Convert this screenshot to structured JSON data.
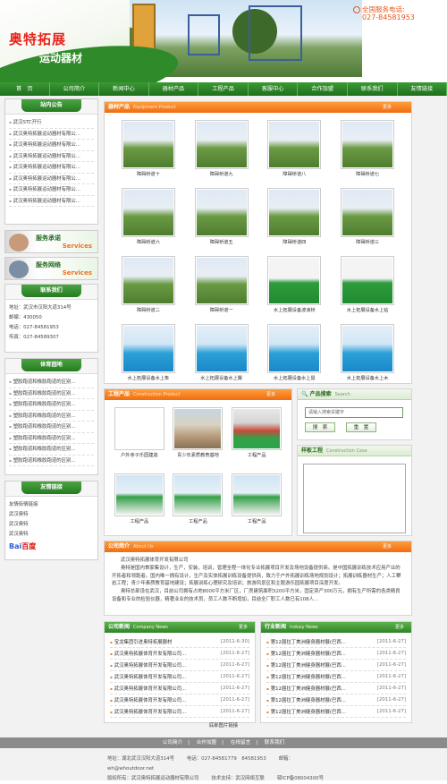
{
  "header": {
    "logo_line1": "奥特拓展",
    "logo_line2": "运动器材",
    "hotline_label": "全国服务电话:",
    "hotline_number": "027-84581953"
  },
  "nav": [
    "首　页",
    "公司简介",
    "新闻中心",
    "器材产品",
    "工程产品",
    "客服中心",
    "合作加盟",
    "联系我们",
    "友情链接"
  ],
  "sidebar": {
    "notice_title": "站内公告",
    "notices": [
      "武汉STC开行",
      "武汉奥特拓展运动器材有限公...",
      "武汉奥特拓展运动器材有限公...",
      "武汉奥特拓展运动器材有限公...",
      "武汉奥特拓展运动器材有限公...",
      "武汉奥特拓展运动器材有限公...",
      "武汉奥特拓展运动器材有限公...",
      "武汉奥特拓展运动器材有限公..."
    ],
    "service1_title": "服务承诺",
    "service1_en": "Services",
    "service2_title": "服务网络",
    "service2_en": "Services",
    "contact_title": "联系我们",
    "contact": [
      "地址：武汉市汉阳大道314号",
      "邮编：430050",
      "电话：027-84581953",
      "传真：027-84589307"
    ],
    "sports_title": "体育园地",
    "sports": [
      "塑胶跑道和橡胶跑道的区别...",
      "塑胶跑道和橡胶跑道的区别...",
      "塑胶跑道和橡胶跑道的区别...",
      "塑胶跑道和橡胶跑道的区别...",
      "塑胶跑道和橡胶跑道的区别...",
      "塑胶跑道和橡胶跑道的区别...",
      "塑胶跑道和橡胶跑道的区别...",
      "塑胶跑道和橡胶跑道的区别..."
    ],
    "links_title": "友情链接",
    "links": [
      "友情街情链接",
      "武汉奥特",
      "武汉奥特",
      "武汉奥特"
    ],
    "baidu": "Bai",
    "baidu2": "百度"
  },
  "products": {
    "title": "器材产品",
    "en": "Equipment Product",
    "more": "更多",
    "items": [
      "障碍桥道十",
      "障碍桥道九",
      "障碍桥道八",
      "障碍桥道七",
      "障碍桥道六",
      "障碍桥道五",
      "障碍桥道四",
      "障碍桥道三",
      "障碍桥道二",
      "障碍桥道一",
      "水上拓展设备波浪桥",
      "水上拓展设备水上钻",
      "水上拓展设备水上象",
      "水上拓展设备水上翼",
      "水上拓展设备水上鼠",
      "水上拓展设备水上木"
    ]
  },
  "construction": {
    "title": "工程产品",
    "en": "Construction Product",
    "more": "更多",
    "items": [
      "户外亲子乐园建造",
      "青少年素质教育基地",
      "工程产品",
      "工程产品",
      "工程产品",
      "工程产品"
    ]
  },
  "search": {
    "title": "产品搜索",
    "en": "Search",
    "placeholder": "请输入搜索关键字",
    "btn_search": "搜　索",
    "btn_reset": "重　置"
  },
  "cases": {
    "title": "样板工程",
    "en": "Construction Case"
  },
  "about": {
    "title": "公司简介",
    "en": "About Us",
    "more": "更多",
    "p1": "武汉奥特拓展体育开发有限公司",
    "p2": "奥特是国内首家集设计，生产，安装，培训，管理全程一体化专业拓展项目开发及场地设备提供商。是中国拓展训练技术应用产业的开拓者和领跑者。国内唯一拥有设计，生产及实体拓展训练设备提供商，致力于户外拓展训练场地规划设计；拓展训练器材生产；人工攀岩工程；青少年素质教育基地建设；拓展训练心理研究及培训；旅游风景区和主题游乐园拓展项目深度开发。",
    "p3": "奥特总部设在武汉，目前公司拥有占地8000平方米厂区，厂房建筑面积3200平方米，固定资产300万元，拥有生产所需的各类精良设备和专业的检验仪器，精著业业的技术员，员工人数不断增加，目前全厂职工人数已有108人..."
  },
  "company_news": {
    "title": "公司新闻",
    "en": "Company News",
    "more": "更多",
    "items": [
      {
        "t": "宝龙集团引进奥特拓展器材",
        "d": "[2011-6-30]"
      },
      {
        "t": "武汉奥特拓展体育开发有限公司...",
        "d": "[2011-6-27]"
      },
      {
        "t": "武汉奥特拓展体育开发有限公司...",
        "d": "[2011-6-27]"
      },
      {
        "t": "武汉奥特拓展体育开发有限公司...",
        "d": "[2011-6-27]"
      },
      {
        "t": "武汉奥特拓展体育开发有限公司...",
        "d": "[2011-6-27]"
      },
      {
        "t": "武汉奥特拓展体育开发有限公司...",
        "d": "[2011-6-27]"
      },
      {
        "t": "武汉奥特拓展体育开发有限公司...",
        "d": "[2011-6-27]"
      }
    ]
  },
  "industry_news": {
    "title": "行业新闻",
    "en": "Indusy News",
    "more": "更多",
    "items": [
      {
        "t": "第12届拉丁美洲健身器材展(巴西...",
        "d": "[2011-6-27]"
      },
      {
        "t": "第12届拉丁美洲健身器材展(巴西...",
        "d": "[2011-6-27]"
      },
      {
        "t": "第12届拉丁美洲健身器材展(巴西...",
        "d": "[2011-6-27]"
      },
      {
        "t": "第12届拉丁美洲健身器材展(巴西...",
        "d": "[2011-6-27]"
      },
      {
        "t": "第12届拉丁美洲健身器材展(巴西...",
        "d": "[2011-6-27]"
      },
      {
        "t": "第12届拉丁美洲健身器材展(巴西...",
        "d": "[2011-6-27]"
      },
      {
        "t": "第12届拉丁美洲健身器材展(巴西...",
        "d": "[2011-6-27]"
      }
    ]
  },
  "footer": {
    "friend_links": "底部图片链接",
    "nav": [
      "公司简介",
      "合作加盟",
      "在线留言",
      "联系我们"
    ],
    "address": "地址：湖北武汉汉阳大道314号",
    "phone": "电话：027-84581779　84581953",
    "email": "邮箱：wh@whoutdoor.net",
    "copyright": "版权所有：武汉奥特拓展运动器材有限公司",
    "support": "技术支持：武汉网络互联",
    "icp": "鄂ICP备08004300号"
  }
}
